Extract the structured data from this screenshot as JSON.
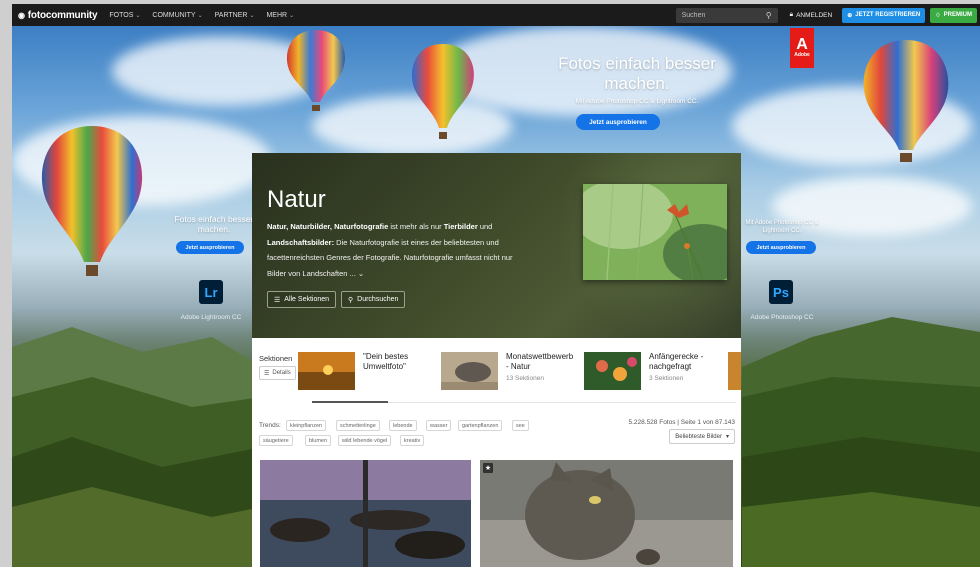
{
  "topnav": {
    "logo": "fotocommunity",
    "items": [
      "FOTOS",
      "COMMUNITY",
      "PARTNER",
      "MEHR"
    ],
    "search_placeholder": "Suchen",
    "login": "ANMELDEN",
    "register": "JETZT REGISTRIEREN",
    "premium": "PREMIUM"
  },
  "ad": {
    "headline_top": "Fotos einfach besser machen.",
    "sub_top": "Mit Adobe Photoshop CC & Lightroom CC.",
    "cta": "Jetzt ausprobieren",
    "adobe_label": "Adobe",
    "left_headline": "Fotos einfach besser machen.",
    "left_cta": "Jetzt ausprobieren",
    "left_app": "Lr",
    "left_app_label": "Adobe Lightroom CC",
    "right_sub": "Mit Adobe Photoshop CC & Lightroom CC.",
    "right_cta": "Jetzt ausprobieren",
    "right_app": "Ps",
    "right_app_label": "Adobe Photoshop CC",
    "colors": {
      "adobe_red": "#e41b16",
      "cta_blue": "#1473e6",
      "lr_bg": "#001e36",
      "lr_fg": "#31a8ff"
    }
  },
  "hero": {
    "title": "Natur",
    "desc_b1": "Natur, Naturbilder, Naturfotografie",
    "desc_t1": " ist mehr als nur ",
    "desc_b2": "Tierbilder",
    "desc_t2": " und ",
    "desc_b3": "Landschaftsbilder:",
    "desc_t3": " Die Naturfotografie ist eines der beliebtesten und facettenreichsten Genres der Fotografie. Naturfotografie umfasst nicht nur Bilder von Landschaften ... ",
    "more_icon": "chevron-down-icon",
    "btn_sections": "Alle Sektionen",
    "btn_search": "Durchsuchen"
  },
  "sections": {
    "title": "Sektionen",
    "details": "Details",
    "cards": [
      {
        "name": "\"Dein bestes Umweltfoto\"",
        "count": ""
      },
      {
        "name": "Monatswettbewerb - Natur",
        "count": "13 Sektionen"
      },
      {
        "name": "Anfängerecke - nachgefragt",
        "count": "3 Sektionen"
      }
    ]
  },
  "trends": {
    "label": "Trends:",
    "tags_row1": [
      "kleinpflanzen",
      "schmetterlinge",
      "lebende",
      "wasser",
      "gartenpflanzen",
      "see"
    ],
    "tags_row2": [
      "säugetiere",
      "blumen",
      "wild lebende vögel",
      "kreativ"
    ]
  },
  "stats": "5.228.528 Fotos | Seite 1 von 87.143",
  "sort": "Beliebteste Bilder"
}
